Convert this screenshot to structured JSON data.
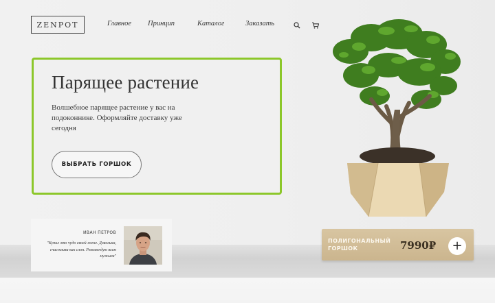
{
  "header": {
    "logo": "ZENPOT",
    "nav": [
      "Главное",
      "Принцип",
      "Каталог",
      "Заказать"
    ],
    "icons": [
      "search-icon",
      "cart-icon"
    ]
  },
  "hero": {
    "title": "Парящее растение",
    "text": "Волшебное парящее растение у вас на подоконнике. Оформляйте доставку уже сегодня",
    "button": "ВЫБРАТЬ ГОРШОК",
    "accent": "#8cc72a"
  },
  "testimonial": {
    "name": "ИВАН ПЕТРОВ",
    "quote": "\"Купил это чудо своей жене. Довольна, счастлива как слон. Рекомендую всем мужьям\""
  },
  "product": {
    "name": "ПОЛИГОНАЛЬНЫЙ ГОРШОК",
    "price": "7990₽",
    "add_label": "+"
  }
}
